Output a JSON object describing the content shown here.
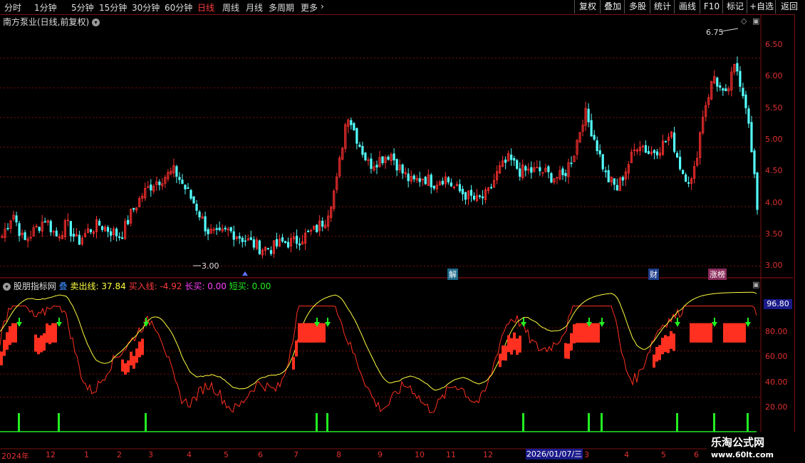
{
  "toolbar": {
    "periods": [
      "分时",
      "1分钟",
      "5分钟",
      "15分钟",
      "30分钟",
      "60分钟",
      "日线",
      "周线",
      "月线",
      "多周期",
      "更多"
    ],
    "more_arrow": "›",
    "right_buttons": [
      "复权",
      "叠加",
      "多股",
      "统计",
      "画线",
      "F10",
      "标记",
      "+自选",
      "返回"
    ]
  },
  "main_chart": {
    "title": "南方泵业(日线,前复权)",
    "high_marker": "6.75",
    "low_marker": "3.00",
    "y_ticks": [
      "6.50",
      "6.00",
      "5.50",
      "5.00",
      "4.50",
      "4.00",
      "3.50",
      "3.00"
    ],
    "ylim": [
      2.85,
      6.95
    ],
    "badges": [
      "解",
      "财",
      "涨榜"
    ]
  },
  "indicator": {
    "name": "股朋指标网",
    "extra": "叠",
    "sell_label": "卖出线:",
    "sell_value": "37.84",
    "buy_label": "买入线:",
    "buy_value": "-4.92",
    "long_label": "长买:",
    "long_value": "0.00",
    "short_label": "短买:",
    "short_value": "0.00",
    "top_value": "96.80",
    "y_ticks": [
      "80.00",
      "60.00",
      "40.00",
      "20.00"
    ]
  },
  "date_axis": {
    "labels": [
      "2024年",
      "12",
      "1",
      "2",
      "3",
      "4",
      "5",
      "6",
      "7",
      "8",
      "9",
      "10",
      "11",
      "12",
      "3",
      "4",
      "5",
      "6"
    ],
    "highlight": "2026/01/07/三"
  },
  "watermark": {
    "line1": "乐淘公式网",
    "line2": "www.60lt.com"
  },
  "colors": {
    "up": "#ff3030",
    "down": "#54ffff",
    "sell_line": "#ffff40",
    "buy_line": "#ff3020",
    "signal": "#22ee22",
    "grid": "#7a1010"
  },
  "chart_data": {
    "type": "candlestick",
    "price_ylim": [
      2.85,
      6.95
    ],
    "price_path_approx": [
      3.5,
      3.9,
      3.4,
      3.6,
      3.8,
      3.5,
      3.7,
      3.4,
      3.6,
      3.7,
      3.6,
      3.5,
      3.9,
      4.2,
      4.4,
      4.5,
      4.6,
      4.3,
      4.0,
      3.6,
      3.5,
      3.6,
      3.5,
      3.4,
      3.3,
      3.3,
      3.4,
      3.4,
      3.5,
      3.6,
      3.8,
      4.4,
      5.6,
      5.1,
      4.7,
      4.8,
      4.9,
      4.6,
      4.4,
      4.5,
      4.4,
      4.5,
      4.3,
      4.2,
      4.1,
      4.2,
      4.6,
      4.8,
      4.6,
      4.6,
      4.6,
      4.5,
      4.5,
      4.9,
      5.6,
      5.1,
      4.5,
      4.3,
      4.7,
      5.1,
      4.9,
      5.0,
      5.2,
      4.6,
      4.4,
      5.6,
      6.2,
      5.8,
      6.4,
      5.7,
      4.0
    ],
    "indicator_ylim": [
      -10,
      100
    ]
  }
}
